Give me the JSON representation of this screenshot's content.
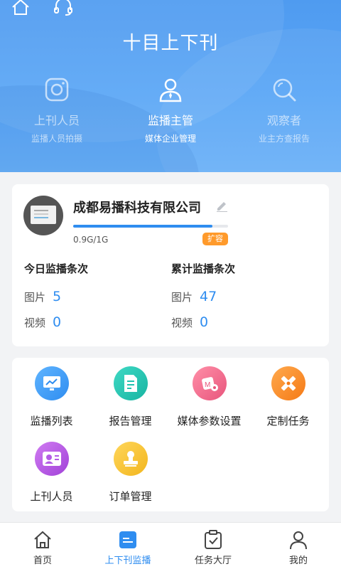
{
  "header": {
    "title": "十目上下刊",
    "top_icons": [
      "home-icon",
      "headset-icon"
    ],
    "roles": [
      {
        "name": "上刊人员",
        "sub": "监播人员拍摄",
        "icon": "camera-icon",
        "active": false
      },
      {
        "name": "监播主管",
        "sub": "媒体企业管理",
        "icon": "supervisor-icon",
        "active": true
      },
      {
        "name": "观察者",
        "sub": "业主方查报告",
        "icon": "search-icon",
        "active": false
      }
    ]
  },
  "company": {
    "name": "成都易播科技有限公司",
    "storage": "0.9G/1G",
    "storage_fraction": 0.9,
    "expand_label": "扩容"
  },
  "stats": {
    "today": {
      "title": "今日监播条次",
      "image_label": "图片",
      "image_value": "5",
      "video_label": "视频",
      "video_value": "0"
    },
    "total": {
      "title": "累计监播条次",
      "image_label": "图片",
      "image_value": "47",
      "video_label": "视频",
      "video_value": "0"
    }
  },
  "menu": [
    {
      "label": "监播列表",
      "icon": "monitor-chart-icon",
      "color": "#3b9bf0"
    },
    {
      "label": "报告管理",
      "icon": "report-document-icon",
      "color": "#22c3b0"
    },
    {
      "label": "媒体参数设置",
      "icon": "media-settings-icon",
      "color": "#f06a8c"
    },
    {
      "label": "定制任务",
      "icon": "custom-task-icon",
      "color": "#ff8a2a"
    },
    {
      "label": "上刊人员",
      "icon": "staff-card-icon",
      "color": "#b45ce6"
    },
    {
      "label": "订单管理",
      "icon": "order-stamp-icon",
      "color": "#f5c232"
    }
  ],
  "nav": [
    {
      "label": "首页",
      "icon": "home-icon",
      "active": false
    },
    {
      "label": "上下刊监播",
      "icon": "monitor-icon",
      "active": true
    },
    {
      "label": "任务大厅",
      "icon": "task-hall-icon",
      "active": false
    },
    {
      "label": "我的",
      "icon": "profile-icon",
      "active": false
    }
  ],
  "colors": {
    "accent": "#2f8df0",
    "header": "#5aa6f6",
    "badge": "#ff9a2b"
  }
}
